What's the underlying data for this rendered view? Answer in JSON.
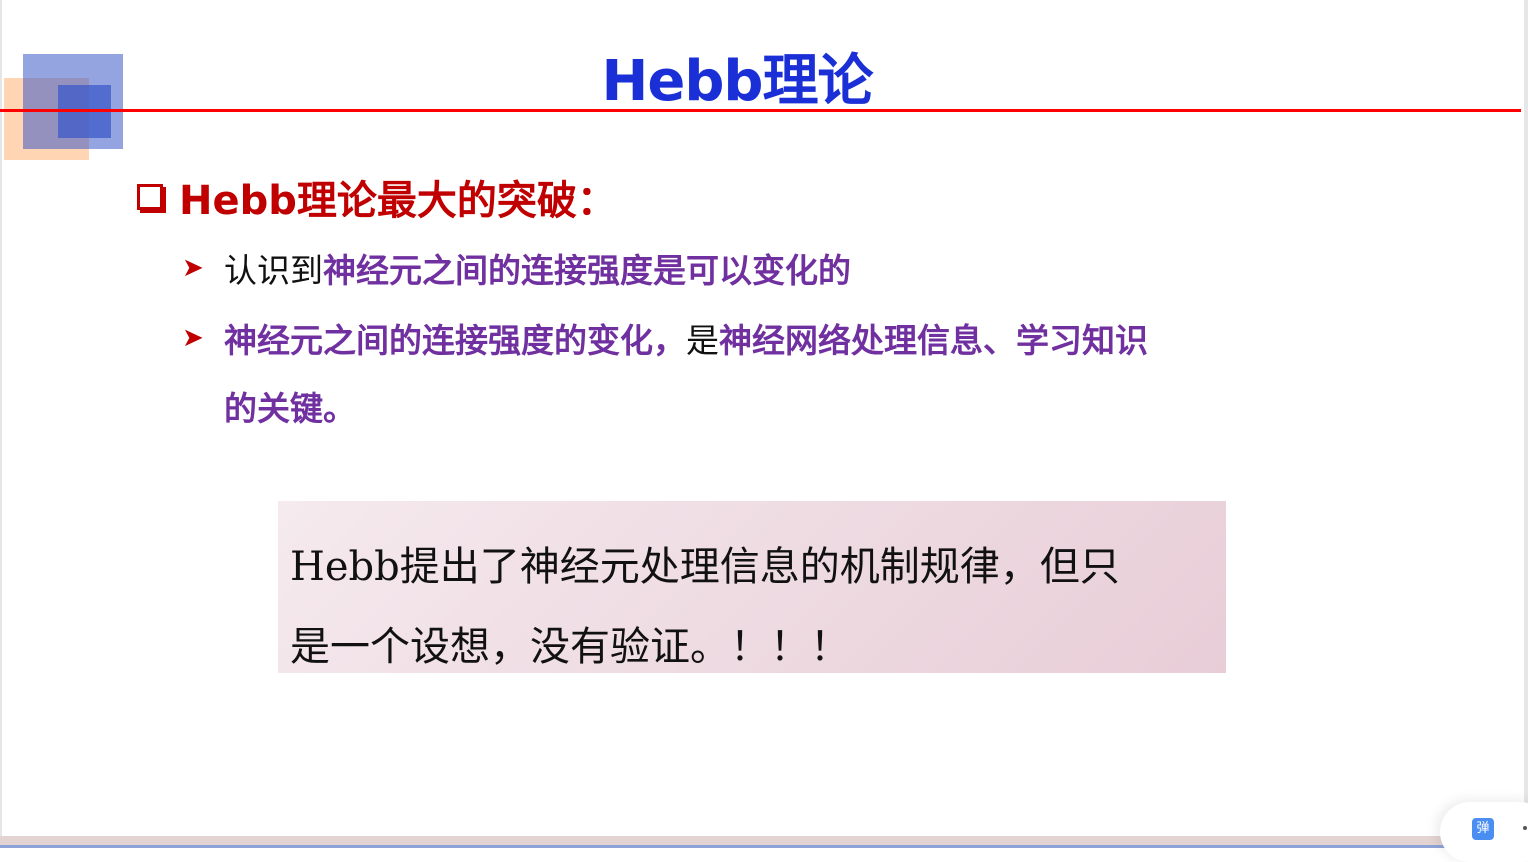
{
  "slide": {
    "title": "Hebb理论",
    "heading": "Hebb理论最大的突破：",
    "bullets": [
      {
        "plain": "认识到",
        "highlight": "神经元之间的连接强度是可以变化的"
      },
      {
        "highlight1": "神经元之间的连接强度的变化，",
        "plain": "是",
        "highlight2": "神经网络处理信息、学习知识",
        "line2": "的关键。"
      }
    ],
    "note_lines": [
      "Hebb提出了神经元处理信息的机制规律，但只",
      "是一个设想，没有验证。！！！"
    ]
  },
  "widget": {
    "danmu_label": "弹"
  },
  "colors": {
    "title": "#1a2fd6",
    "heading": "#c00000",
    "highlight": "#7030a0",
    "rule": "#ff0000"
  }
}
